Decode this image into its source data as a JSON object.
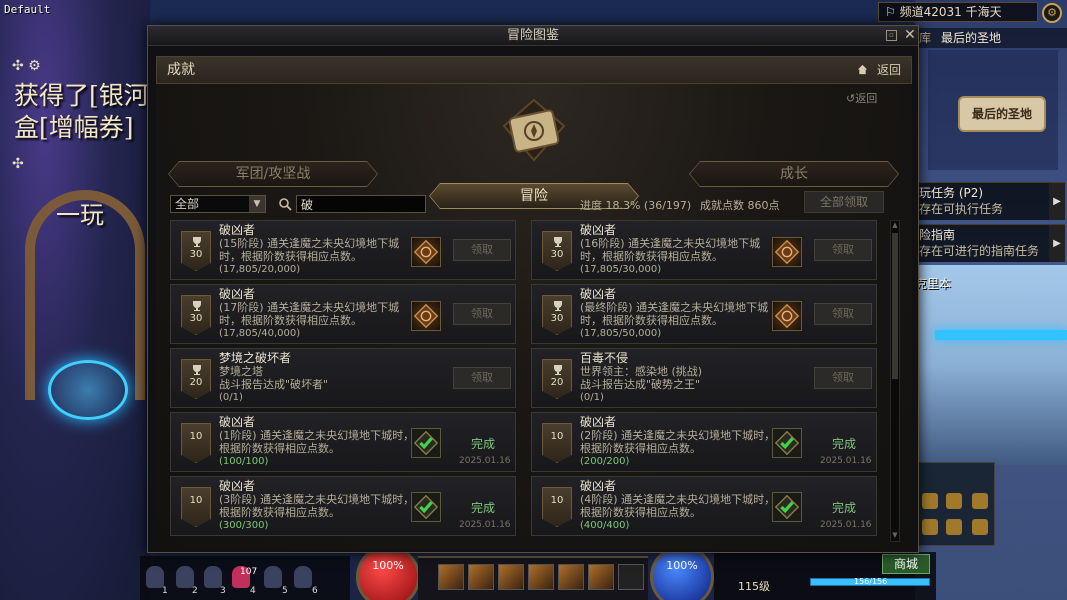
{
  "background": {
    "default_label": "Default",
    "gain_message_line1": "获得了[银河",
    "gain_message_line1_highlight": "[银河",
    "gain_message_line2": "盒[增幅券]",
    "gain_message_line3": "一玩",
    "channel": "频道42031 千海天",
    "map_title_left": "库",
    "map_title": "最后的圣地",
    "map_node": "最后的圣地",
    "side_quests": [
      {
        "title": "玩任务 (P2)",
        "sub": "存在可执行任务"
      },
      {
        "title": "险指南",
        "sub": "存在可进行的指南任务"
      }
    ],
    "nameplate": "克里本",
    "hp_orb": "100%",
    "mp_orb": "100%",
    "level": "115级",
    "xp_text": "156/156",
    "shop_button": "商城",
    "potion_numbers": [
      "1",
      "2",
      "3",
      "4",
      "5",
      "6"
    ],
    "potion_count": "107"
  },
  "window": {
    "title": "冒险图鉴",
    "section_title": "成就",
    "return_label": "返回",
    "return_small": "返回",
    "tabs": [
      {
        "label": "军团/攻坚战",
        "active": false
      },
      {
        "label": "冒险",
        "active": true
      },
      {
        "label": "成长",
        "active": false
      }
    ],
    "filter": {
      "selected": "全部"
    },
    "search": {
      "value": "破"
    },
    "progress": "进度 18.3% (36/197)",
    "points": "成就点数 860点",
    "claim_all": "全部领取",
    "claim_label": "领取",
    "done_label": "完成"
  },
  "cards": [
    {
      "name": "破凶者",
      "desc": "(15阶段) 通关逢魔之未央幻境地下城时，根据阶数获得相应点数。",
      "progress": "(17,805/20,000)",
      "points": "30",
      "done": false
    },
    {
      "name": "破凶者",
      "desc": "(16阶段) 通关逢魔之未央幻境地下城时，根据阶数获得相应点数。",
      "progress": "(17,805/30,000)",
      "points": "30",
      "done": false
    },
    {
      "name": "破凶者",
      "desc": "(17阶段) 通关逢魔之未央幻境地下城时，根据阶数获得相应点数。",
      "progress": "(17,805/40,000)",
      "points": "30",
      "done": false
    },
    {
      "name": "破凶者",
      "desc": "(最终阶段) 通关逢魔之未央幻境地下城时，根据阶数获得相应点数。",
      "progress": "(17,805/50,000)",
      "points": "30",
      "done": false
    },
    {
      "name": "梦境之破坏者",
      "desc": "梦境之塔\n战斗报告达成\"破坏者\"",
      "progress": "(0/1)",
      "points": "20",
      "done": false
    },
    {
      "name": "百毒不侵",
      "desc": "世界领主：感染地 (挑战)\n战斗报告达成\"破势之王\"",
      "progress": "(0/1)",
      "points": "20",
      "done": false
    },
    {
      "name": "破凶者",
      "desc": "(1阶段) 通关逢魔之未央幻境地下城时，根据阶数获得相应点数。",
      "progress": "(100/100)",
      "points": "10",
      "done": true,
      "date": "2025.01.16"
    },
    {
      "name": "破凶者",
      "desc": "(2阶段) 通关逢魔之未央幻境地下城时，根据阶数获得相应点数。",
      "progress": "(200/200)",
      "points": "10",
      "done": true,
      "date": "2025.01.16"
    },
    {
      "name": "破凶者",
      "desc": "(3阶段) 通关逢魔之未央幻境地下城时，根据阶数获得相应点数。",
      "progress": "(300/300)",
      "points": "10",
      "done": true,
      "date": "2025.01.16"
    },
    {
      "name": "破凶者",
      "desc": "(4阶段) 通关逢魔之未央幻境地下城时，根据阶数获得相应点数。",
      "progress": "(400/400)",
      "points": "10",
      "done": true,
      "date": "2025.01.16"
    }
  ],
  "colors": {
    "accent_gold": "#c8a050",
    "done_green": "#7ec87a",
    "window_bg": "#111113"
  }
}
